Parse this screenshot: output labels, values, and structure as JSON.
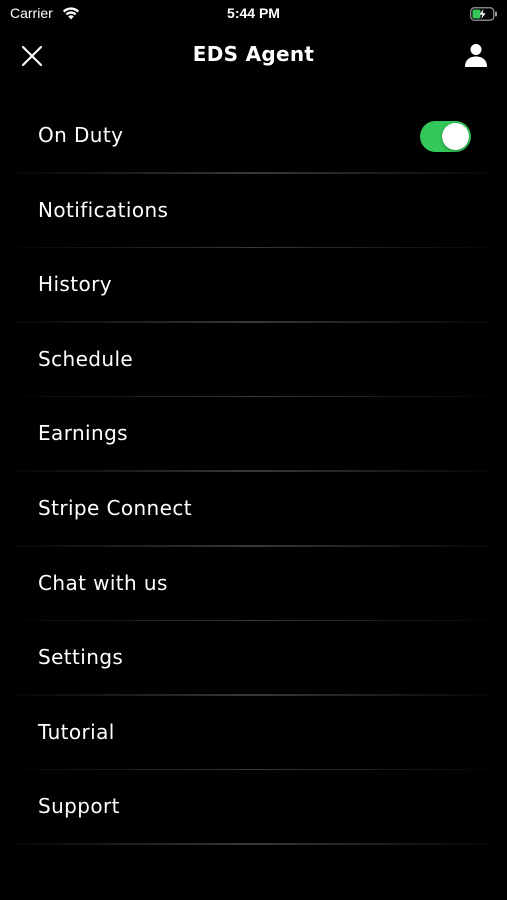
{
  "status_bar": {
    "carrier": "Carrier",
    "time": "5:44 PM",
    "wifi_icon": "wifi-icon",
    "battery_icon": "battery-charging-icon",
    "battery_color": "#34c759"
  },
  "nav": {
    "title": "EDS Agent",
    "close_icon": "close-icon",
    "profile_icon": "person-icon"
  },
  "menu": {
    "on_duty": {
      "label": "On Duty",
      "toggle_on": true,
      "toggle_color": "#34c759"
    },
    "items": [
      {
        "label": "Notifications"
      },
      {
        "label": "History"
      },
      {
        "label": "Schedule"
      },
      {
        "label": "Earnings"
      },
      {
        "label": "Stripe Connect"
      },
      {
        "label": "Chat with us"
      },
      {
        "label": "Settings"
      },
      {
        "label": "Tutorial"
      },
      {
        "label": "Support"
      }
    ]
  }
}
